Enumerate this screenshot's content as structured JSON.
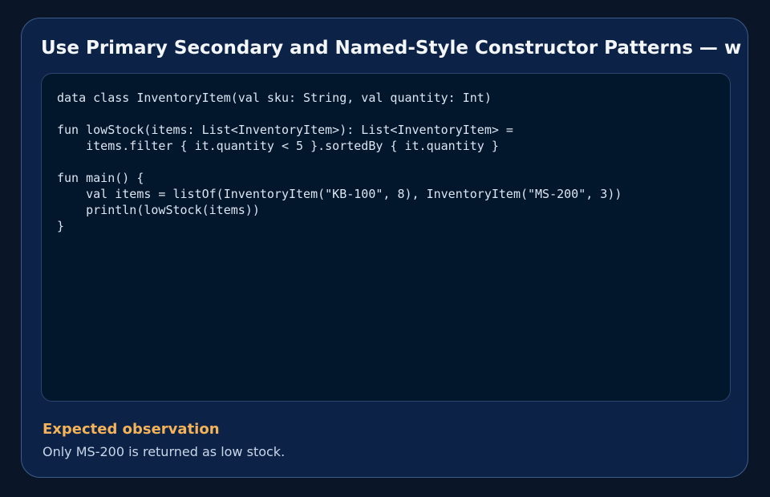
{
  "card": {
    "title": "Use Primary Secondary and Named-Style Constructor Patterns — w"
  },
  "code": {
    "language": "kotlin",
    "source": "data class InventoryItem(val sku: String, val quantity: Int)\n\nfun lowStock(items: List<InventoryItem>): List<InventoryItem> =\n    items.filter { it.quantity < 5 }.sortedBy { it.quantity }\n\nfun main() {\n    val items = listOf(InventoryItem(\"KB-100\", 8), InventoryItem(\"MS-200\", 3))\n    println(lowStock(items))\n}"
  },
  "observation": {
    "heading": "Expected observation",
    "text": "Only MS-200 is returned as low stock."
  },
  "colors": {
    "background": "#0a1628",
    "card": "#0c2246",
    "code_panel": "#02162c",
    "accent": "#f2b35b"
  }
}
